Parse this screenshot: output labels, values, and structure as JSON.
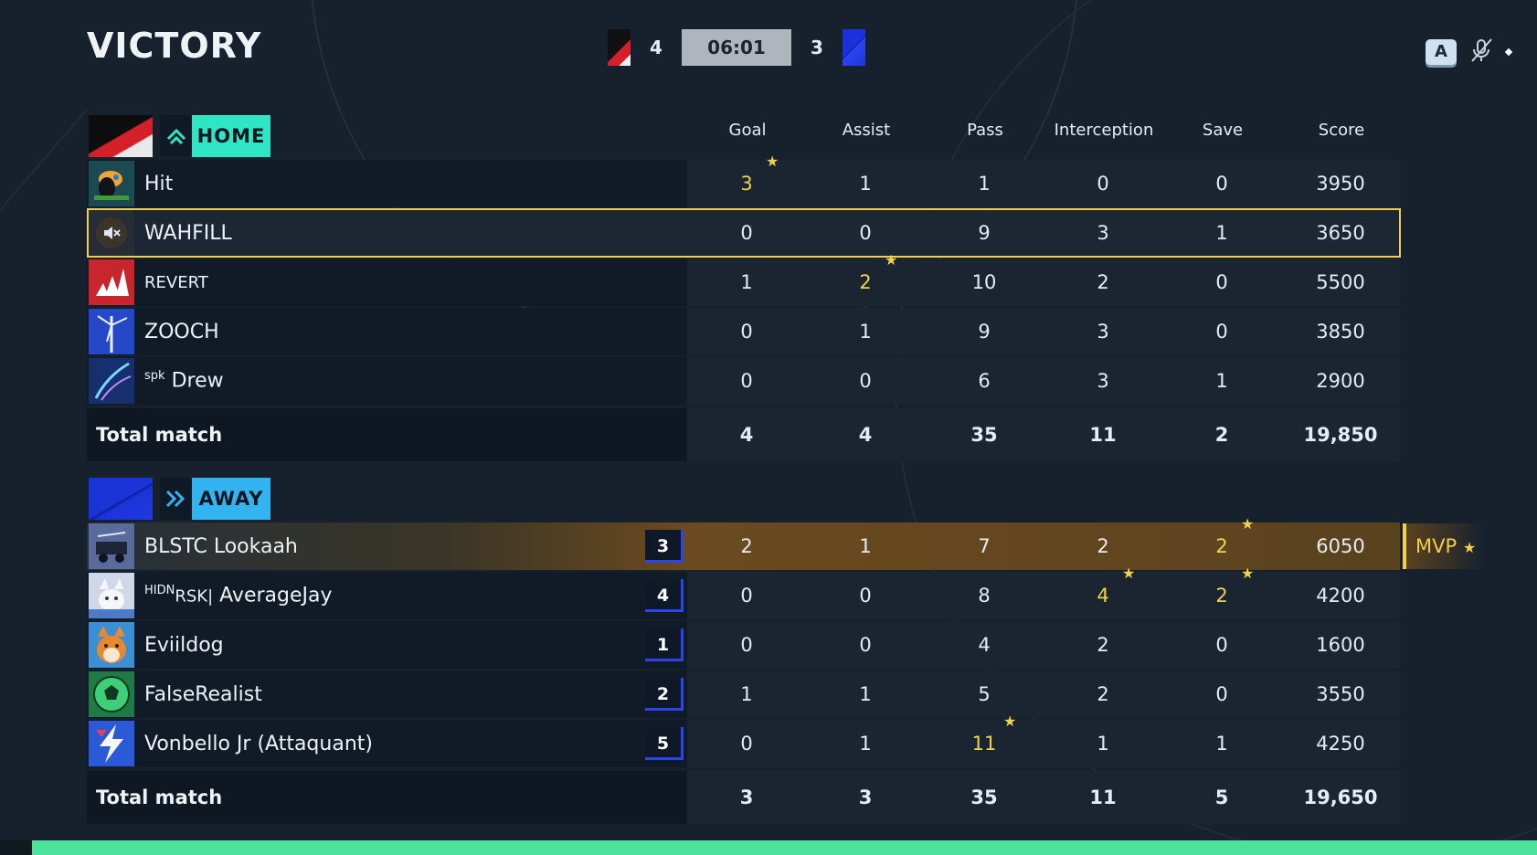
{
  "header": {
    "title": "VICTORY",
    "home_score": "4",
    "timer": "06:01",
    "away_score": "3",
    "key_hint": "A"
  },
  "columns": [
    "Goal",
    "Assist",
    "Pass",
    "Interception",
    "Save",
    "Score"
  ],
  "home": {
    "tag": "HOME",
    "players": [
      {
        "name": "Hit",
        "stats": [
          "3",
          "1",
          "1",
          "0",
          "0",
          "3950"
        ],
        "highlight": [
          0
        ]
      },
      {
        "name": "WAHFILL",
        "stats": [
          "0",
          "0",
          "9",
          "3",
          "1",
          "3650"
        ],
        "highlight": []
      },
      {
        "name": "REVERT",
        "stats": [
          "1",
          "2",
          "10",
          "2",
          "0",
          "5500"
        ],
        "highlight": [
          1
        ]
      },
      {
        "name": "ZOOCH",
        "stats": [
          "0",
          "1",
          "9",
          "3",
          "0",
          "3850"
        ],
        "highlight": []
      },
      {
        "name_prefix": "spk",
        "name": "Drew",
        "stats": [
          "0",
          "0",
          "6",
          "3",
          "1",
          "2900"
        ],
        "highlight": []
      }
    ],
    "total": {
      "label": "Total match",
      "stats": [
        "4",
        "4",
        "35",
        "11",
        "2",
        "19,850"
      ]
    }
  },
  "away": {
    "tag": "AWAY",
    "players": [
      {
        "name": "BLSTC Lookaah",
        "rank": "3",
        "stats": [
          "2",
          "1",
          "7",
          "2",
          "2",
          "6050"
        ],
        "highlight": [
          4
        ],
        "mvp": "MVP"
      },
      {
        "name_prefix": "HIDN",
        "name_clan": "RSK|",
        "name": "AverageJay",
        "rank": "4",
        "stats": [
          "0",
          "0",
          "8",
          "4",
          "2",
          "4200"
        ],
        "highlight": [
          3,
          4
        ]
      },
      {
        "name": "Eviildog",
        "rank": "1",
        "stats": [
          "0",
          "0",
          "4",
          "2",
          "0",
          "1600"
        ],
        "highlight": []
      },
      {
        "name": "FalseRealist",
        "rank": "2",
        "stats": [
          "1",
          "1",
          "5",
          "2",
          "0",
          "3550"
        ],
        "highlight": []
      },
      {
        "name": "Vonbello Jr (Attaquant)",
        "rank": "5",
        "stats": [
          "0",
          "1",
          "11",
          "1",
          "1",
          "4250"
        ],
        "highlight": [
          2
        ]
      }
    ],
    "total": {
      "label": "Total match",
      "stats": [
        "3",
        "3",
        "35",
        "11",
        "5",
        "19,650"
      ]
    }
  },
  "colors": {
    "home_accent": "#2ee6c4",
    "away_accent": "#33b4f0",
    "highlight": "#f2d24c",
    "mvp_gold": "#f2cf4a"
  },
  "icons": {
    "home_emblem": "chevron-up-icon",
    "away_emblem": "double-chevron-right-icon",
    "muted": "speaker-muted-icon",
    "voice_off": "microphone-off-icon",
    "star": "star-icon"
  }
}
